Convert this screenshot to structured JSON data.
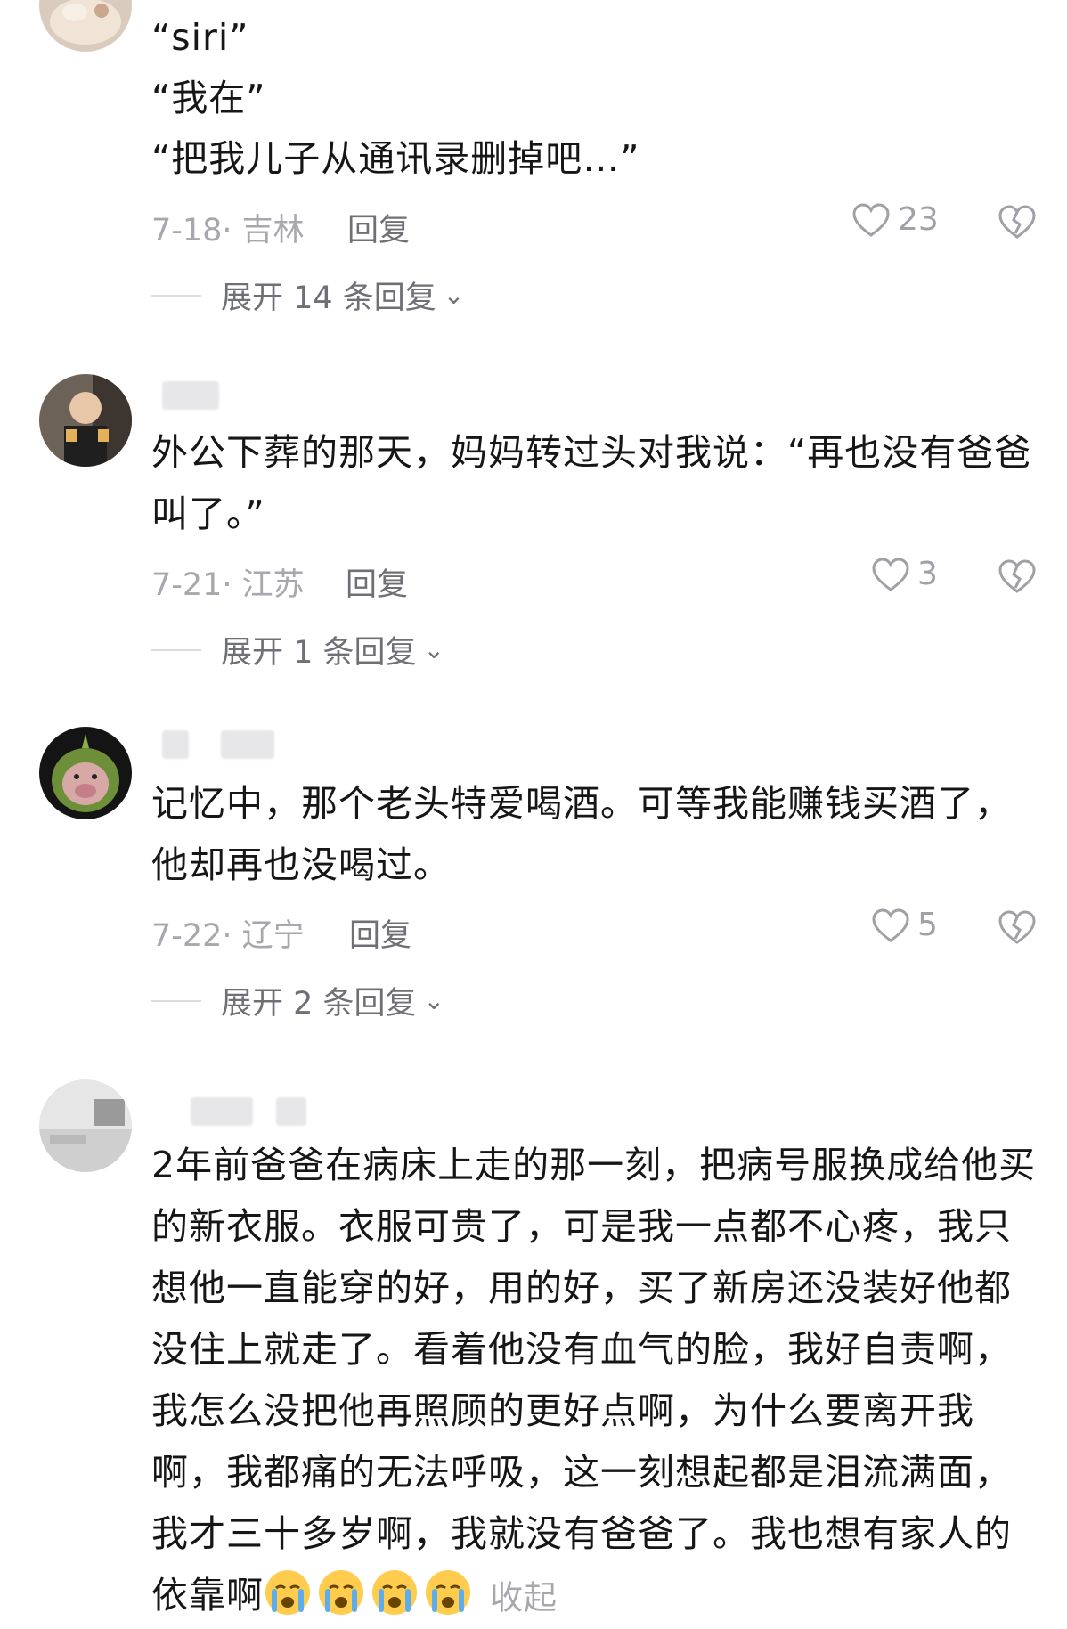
{
  "comments": [
    {
      "lines": [
        "“siri”",
        "“我在”",
        "“把我儿子从通讯录删掉吧…”"
      ],
      "date_loc": "7-18· 吉林",
      "reply_label": "回复",
      "likes": "23",
      "expand_label": "展开 14 条回复"
    },
    {
      "text": "外公下葬的那天，妈妈转过头对我说：“再也没有爸爸叫了。”",
      "date_loc": "7-21· 江苏",
      "reply_label": "回复",
      "likes": "3",
      "expand_label": "展开 1 条回复"
    },
    {
      "text": "记忆中，那个老头特爱喝酒。可等我能赚钱买酒了，他却再也没喝过。",
      "date_loc": "7-22· 辽宁",
      "reply_label": "回复",
      "likes": "5",
      "expand_label": "展开 2 条回复"
    },
    {
      "text": "2年前爸爸在病床上走的那一刻，把病号服换成给他买的新衣服。衣服可贵了，可是我一点都不心疼，我只想他一直能穿的好，用的好，买了新房还没装好他都没住上就走了。看着他没有血气的脸，我好自责啊，我怎么没把他再照顾的更好点啊，为什么要离开我啊，我都痛的无法呼吸，这一刻想起都是泪流满面，我才三十多岁啊，我就没有爸爸了。我也想有家人的依靠啊",
      "collapse_label": "收起"
    }
  ],
  "icons": {
    "like": "heart-outline-icon",
    "dislike": "broken-heart-icon",
    "expand": "chevron-down-icon",
    "emoji": "crying-face-emoji"
  }
}
